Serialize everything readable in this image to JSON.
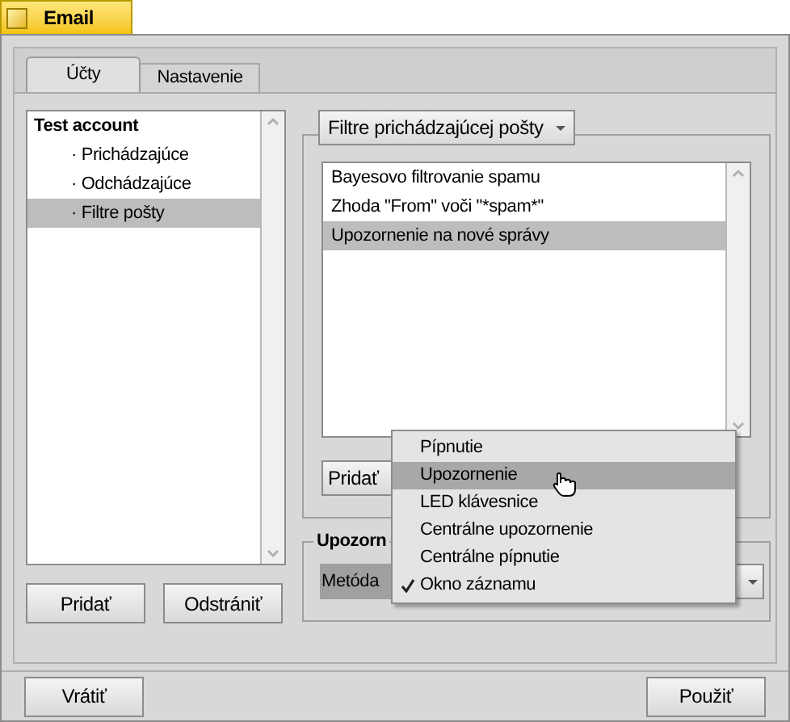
{
  "window": {
    "title": "Email"
  },
  "tabs": [
    {
      "label": "Účty",
      "selected": true
    },
    {
      "label": "Nastavenie",
      "selected": false
    }
  ],
  "accounts": [
    {
      "label": "Test account",
      "kind": "account",
      "selected": false
    },
    {
      "label": "· Prichádzajúce",
      "kind": "sub",
      "selected": false
    },
    {
      "label": "· Odchádzajúce",
      "kind": "sub",
      "selected": false
    },
    {
      "label": "· Filtre pošty",
      "kind": "sub",
      "selected": true
    }
  ],
  "account_buttons": [
    "Pridať",
    "Odstrániť"
  ],
  "filters": {
    "dropdown": "Filtre prichádzajúcej pošty",
    "add_button": "Pridať",
    "items": [
      {
        "label": "Bayesovo filtrovanie spamu",
        "selected": false
      },
      {
        "label": "Zhoda \"From\" voči \"*spam*\"",
        "selected": false
      },
      {
        "label": "Upozornenie na nové správy",
        "selected": true
      }
    ]
  },
  "notification": {
    "group_label": "Upozorn",
    "method_label": "Metóda"
  },
  "menu": [
    {
      "label": "Pípnutie",
      "highlighted": false,
      "checked": false
    },
    {
      "label": "Upozornenie",
      "highlighted": true,
      "checked": false
    },
    {
      "label": "LED klávesnice",
      "highlighted": false,
      "checked": false
    },
    {
      "label": "Centrálne upozornenie",
      "highlighted": false,
      "checked": false
    },
    {
      "label": "Centrálne pípnutie",
      "highlighted": false,
      "checked": false
    },
    {
      "label": "Okno záznamu",
      "highlighted": false,
      "checked": true
    }
  ],
  "buttons": [
    "Vrátiť",
    "Použiť"
  ]
}
